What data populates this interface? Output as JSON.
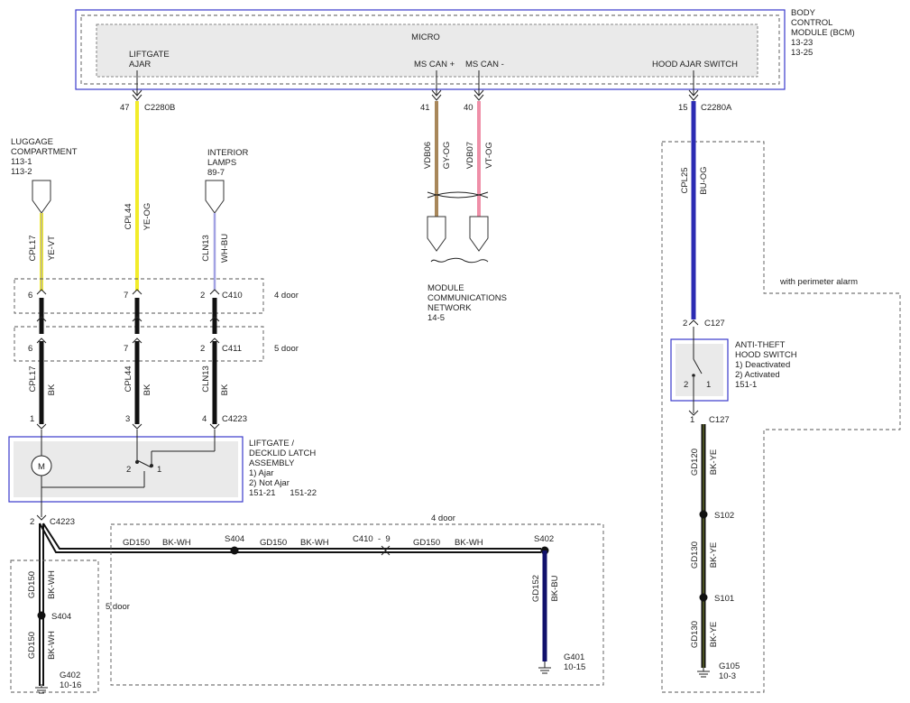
{
  "bcm": {
    "title_lines": [
      "BODY",
      "CONTROL",
      "MODULE (BCM)",
      "13-23",
      "13-25"
    ],
    "micro": "MICRO",
    "liftgate_ajar": [
      "LIFTGATE",
      "AJAR"
    ],
    "ms_can_plus": "MS CAN +",
    "ms_can_minus": "MS CAN -",
    "hood_ajar": "HOOD AJAR SWITCH"
  },
  "c2280b": {
    "pin": "47",
    "label": "C2280B"
  },
  "c2280a": {
    "pin": "15",
    "label": "C2280A"
  },
  "pins_mscan": {
    "p41": "41",
    "p40": "40"
  },
  "luggage": [
    "LUGGAGE",
    "COMPARTMENT",
    "113-1",
    "113-2"
  ],
  "interior": [
    "INTERIOR",
    "LAMPS",
    "89-7"
  ],
  "wires": {
    "cpl17": "CPL17",
    "ye_vt": "YE-VT",
    "cpl44": "CPL44",
    "ye_og": "YE-OG",
    "cln13": "CLN13",
    "wh_bu": "WH-BU",
    "vdb06": "VDB06",
    "gy_og": "GY-OG",
    "vdb07": "VDB07",
    "vt_og": "VT-OG",
    "cpl25": "CPL25",
    "bu_og": "BU-OG",
    "bk": "BK",
    "gd120": "GD120",
    "bk_ye": "BK-YE",
    "gd130": "GD130",
    "gd150": "GD150",
    "bk_wh": "BK-WH",
    "gd152": "GD152",
    "bk_bu": "BK-BU"
  },
  "c410": {
    "p6": "6",
    "p7": "7",
    "p2": "2",
    "label": "C410",
    "note": "4 door"
  },
  "c411": {
    "p6": "6",
    "p7": "7",
    "p2": "2",
    "label": "C411",
    "note": "5 door"
  },
  "c4223": {
    "p1": "1",
    "p3": "3",
    "p4": "4",
    "label": "C4223",
    "p2": "2"
  },
  "mcn": [
    "MODULE",
    "COMMUNICATIONS",
    "NETWORK",
    "14-5"
  ],
  "perimeter": "with perimeter alarm",
  "c127": {
    "top_pin": "2",
    "label": "C127",
    "bottom_pin": "1"
  },
  "antitheft": [
    "ANTI-THEFT",
    "HOOD SWITCH",
    "1) Deactivated",
    "2) Activated",
    "151-1"
  ],
  "latch": [
    "LIFTGATE /",
    "DECKLID LATCH",
    "ASSEMBLY",
    "1) Ajar",
    "2) Not Ajar",
    "151-21      151-22"
  ],
  "latch_pins": {
    "p2": "2",
    "p1": "1"
  },
  "switch_pins": {
    "p2": "2",
    "p1": "1"
  },
  "motor": "M",
  "splices": {
    "s102": "S102",
    "s101": "S101",
    "s404": "S404",
    "s402": "S402"
  },
  "grounds": {
    "g105": [
      "G105",
      "10-3"
    ],
    "g401": [
      "G401",
      "10-15"
    ],
    "g402": [
      "G402",
      "10-16"
    ]
  },
  "harness": {
    "four_door": "4 door",
    "five_door": "5 door",
    "c410_9": "C410  -  9"
  },
  "colors": {
    "yellow": "#f2ec2a",
    "violet": "#9b8fd6",
    "blue": "#2b2bb3",
    "tan": "#a8875a",
    "pink": "#ef8fa8",
    "black": "#111111",
    "greenish": "#6f7a2c",
    "navy": "#10106b",
    "border_blue": "#3a3acc"
  }
}
